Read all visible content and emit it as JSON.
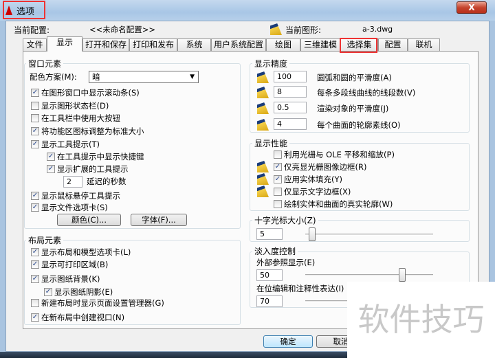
{
  "window": {
    "title": "选项",
    "close": "X"
  },
  "header": {
    "profile_label": "当前配置:",
    "profile_value": "<<未命名配置>>",
    "drawing_label": "当前图形:",
    "drawing_value": "a-3.dwg"
  },
  "tabs": [
    {
      "label": "文件"
    },
    {
      "label": "显示",
      "selected": true
    },
    {
      "label": "打开和保存"
    },
    {
      "label": "打印和发布"
    },
    {
      "label": "系统"
    },
    {
      "label": "用户系统配置"
    },
    {
      "label": "绘图"
    },
    {
      "label": "三维建模"
    },
    {
      "label": "选择集"
    },
    {
      "label": "配置"
    },
    {
      "label": "联机"
    }
  ],
  "window_elements": {
    "title": "窗口元素",
    "scheme_label": "配色方案(M):",
    "scheme_value": "暗",
    "checks": [
      {
        "label": "在图形窗口中显示滚动条(S)",
        "checked": true
      },
      {
        "label": "显示图形状态栏(D)",
        "checked": false
      },
      {
        "label": "在工具栏中使用大按钮",
        "checked": false
      },
      {
        "label": "将功能区图标调整为标准大小",
        "checked": true
      },
      {
        "label": "显示工具提示(T)",
        "checked": true
      },
      {
        "label": "在工具提示中显示快捷键",
        "checked": true
      },
      {
        "label": "显示扩展的工具提示",
        "checked": true
      },
      {
        "label": "显示鼠标悬停工具提示",
        "checked": true
      },
      {
        "label": "显示文件选项卡(S)",
        "checked": true
      }
    ],
    "delay_value": "2",
    "delay_label": "延迟的秒数",
    "colors_button": "颜色(C)...",
    "fonts_button": "字体(F)..."
  },
  "layout_elements": {
    "title": "布局元素",
    "checks": [
      {
        "label": "显示布局和模型选项卡(L)",
        "checked": true
      },
      {
        "label": "显示可打印区域(B)",
        "checked": true
      },
      {
        "label": "显示图纸背景(K)",
        "checked": true
      },
      {
        "label": "显示图纸阴影(E)",
        "checked": true
      },
      {
        "label": "新建布局时显示页面设置管理器(G)",
        "checked": false
      },
      {
        "label": "在新布局中创建视口(N)",
        "checked": true
      }
    ]
  },
  "precision": {
    "title": "显示精度",
    "rows": [
      {
        "value": "100",
        "label": "圆弧和圆的平滑度(A)"
      },
      {
        "value": "8",
        "label": "每条多段线曲线的线段数(V)"
      },
      {
        "value": "0.5",
        "label": "渲染对象的平滑度(J)"
      },
      {
        "value": "4",
        "label": "每个曲面的轮廓素线(O)"
      }
    ]
  },
  "performance": {
    "title": "显示性能",
    "checks": [
      {
        "label": "利用光栅与 OLE 平移和缩放(P)",
        "checked": false,
        "icon": false
      },
      {
        "label": "仅亮显光栅图像边框(R)",
        "checked": true,
        "icon": true
      },
      {
        "label": "应用实体填充(Y)",
        "checked": true,
        "icon": true
      },
      {
        "label": "仅显示文字边框(X)",
        "checked": false,
        "icon": true
      },
      {
        "label": "绘制实体和曲面的真实轮廓(W)",
        "checked": false,
        "icon": false
      }
    ]
  },
  "crosshair": {
    "title": "十字光标大小(Z)",
    "value": "5",
    "level_percent": 5
  },
  "fade": {
    "title": "淡入度控制",
    "xref_label": "外部参照显示(E)",
    "xref_value": "50",
    "xref_level": 50,
    "inplace_label": "在位编辑和注释性表达(I)",
    "inplace_value": "70"
  },
  "buttons": {
    "ok": "确定",
    "cancel": "取消"
  },
  "watermark": "软件技巧"
}
